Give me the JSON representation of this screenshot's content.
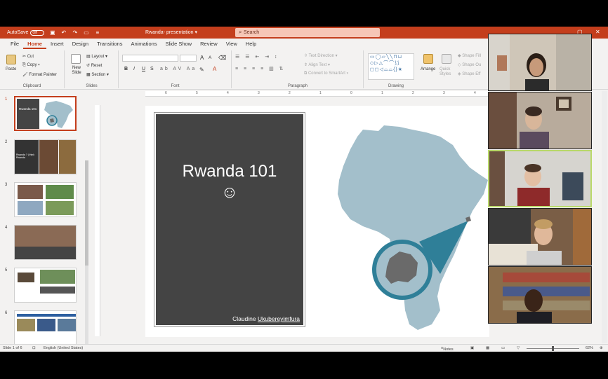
{
  "titlebar": {
    "autosave_label": "AutoSave",
    "autosave_state": "Off",
    "doc_title": "Rwanda- presentation",
    "search_placeholder": "Search"
  },
  "menu": {
    "tabs": [
      "File",
      "Home",
      "Insert",
      "Design",
      "Transitions",
      "Animations",
      "Slide Show",
      "Review",
      "View",
      "Help"
    ],
    "active": "Home"
  },
  "ribbon": {
    "clipboard": {
      "paste": "Paste",
      "cut": "Cut",
      "copy": "Copy",
      "format_painter": "Format Painter",
      "label": "Clipboard"
    },
    "slides": {
      "new_slide": "New Slide",
      "layout": "Layout",
      "reset": "Reset",
      "section": "Section",
      "label": "Slides"
    },
    "font": {
      "label": "Font",
      "bold": "B",
      "italic": "I",
      "underline": "U",
      "strike": "S",
      "size_up": "A",
      "size_down": "A",
      "font_color": "A"
    },
    "paragraph": {
      "text_direction": "Text Direction",
      "align_text": "Align Text",
      "smartart": "Convert to SmartArt",
      "label": "Paragraph"
    },
    "drawing": {
      "arrange": "Arrange",
      "quick_styles": "Quick Styles",
      "shape_fill": "Shape Fill",
      "shape_outline": "Shape Ou",
      "shape_effects": "Shape Eff",
      "label": "Drawing"
    }
  },
  "thumbnails": [
    {
      "number": "1",
      "selected": true,
      "title": "Rwanda 101"
    },
    {
      "number": "2",
      "selected": false,
      "title": "Rwanda ? | think Rwanda"
    },
    {
      "number": "3",
      "selected": false
    },
    {
      "number": "4",
      "selected": false
    },
    {
      "number": "5",
      "selected": false
    },
    {
      "number": "6",
      "selected": false
    }
  ],
  "ruler": {
    "ticks": [
      "6",
      "5",
      "4",
      "3",
      "2",
      "1",
      "0",
      "1",
      "2",
      "3",
      "4"
    ]
  },
  "slide": {
    "title": "Rwanda 101",
    "smiley": "☺",
    "author_first": "Claudine ",
    "author_last": "Ukubereyimfura"
  },
  "status": {
    "slide_of": "Slide 1 of 6",
    "language": "English (United States)",
    "notes": "Notes",
    "zoom": "62%"
  },
  "video_tiles": [
    {
      "participant": 1,
      "speaking": false
    },
    {
      "participant": 2,
      "speaking": false
    },
    {
      "participant": 3,
      "speaking": true
    },
    {
      "participant": 4,
      "speaking": false
    },
    {
      "participant": 5,
      "speaking": false
    }
  ],
  "colors": {
    "accent": "#c43e1c",
    "map_fill": "#a3bfcb",
    "callout_ring": "#2f7f98",
    "rwanda_fill": "#6a6a6a",
    "slide_box": "#444444"
  }
}
